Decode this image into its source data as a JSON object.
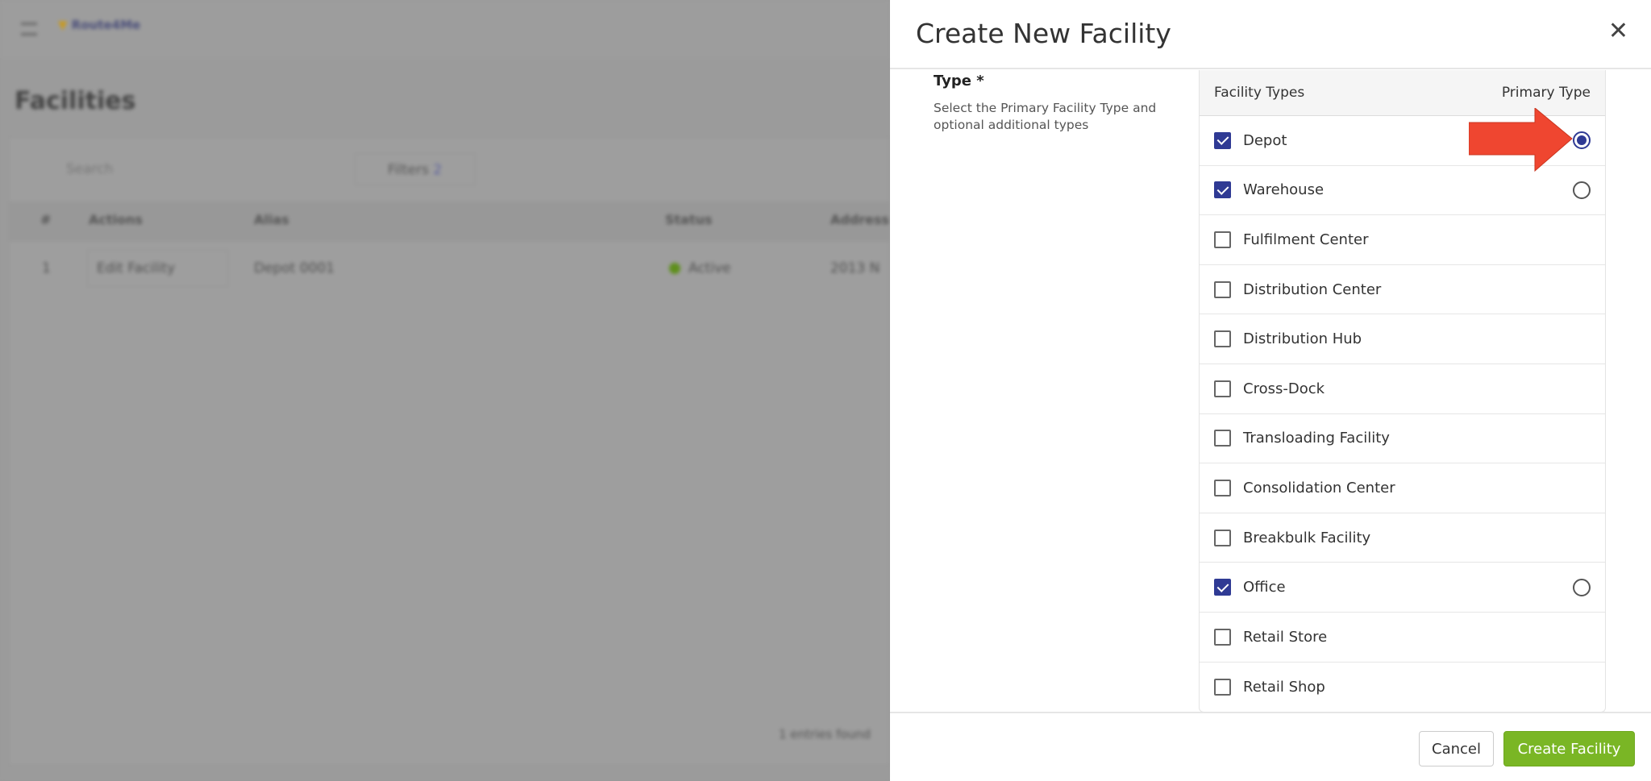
{
  "background": {
    "app_logo": "Route4Me",
    "page_title": "Facilities",
    "search_placeholder": "Search",
    "filters_label": "Filters",
    "filters_count": "2",
    "columns": [
      "#",
      "Actions",
      "Alias",
      "Status",
      "Address"
    ],
    "rows": [
      {
        "index": "1",
        "action": "Edit Facility",
        "alias": "Depot 0001",
        "status": "Active",
        "address": "2013 N"
      }
    ],
    "footer": "1 entries found"
  },
  "dialog": {
    "title": "Create New Facility",
    "close_icon": "close-icon",
    "type_label": "Type *",
    "type_description": "Select the Primary Facility Type and optional additional types",
    "table": {
      "col_types": "Facility Types",
      "col_primary": "Primary Type",
      "rows": [
        {
          "label": "Depot",
          "checked": true,
          "primary": true
        },
        {
          "label": "Warehouse",
          "checked": true,
          "primary": false
        },
        {
          "label": "Fulfilment Center",
          "checked": false
        },
        {
          "label": "Distribution Center",
          "checked": false
        },
        {
          "label": "Distribution Hub",
          "checked": false
        },
        {
          "label": "Cross-Dock",
          "checked": false
        },
        {
          "label": "Transloading Facility",
          "checked": false
        },
        {
          "label": "Consolidation Center",
          "checked": false
        },
        {
          "label": "Breakbulk Facility",
          "checked": false
        },
        {
          "label": "Office",
          "checked": true,
          "primary": false
        },
        {
          "label": "Retail Store",
          "checked": false
        },
        {
          "label": "Retail Shop",
          "checked": false
        }
      ]
    },
    "cancel_label": "Cancel",
    "create_label": "Create Facility"
  },
  "colors": {
    "accent": "#2f3a94",
    "create_button": "#7ab625",
    "annotation_arrow": "#ef4630"
  }
}
